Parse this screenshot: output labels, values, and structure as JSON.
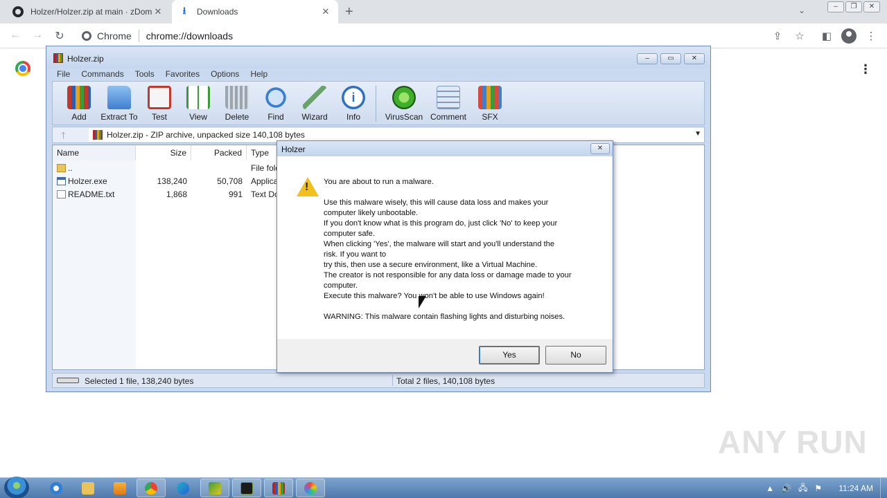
{
  "browser": {
    "tabs": [
      {
        "title": "Holzer/Holzer.zip at main · zDom",
        "icon": "github-icon"
      },
      {
        "title": "Downloads",
        "icon": "download-icon"
      }
    ],
    "site_chip": "Chrome",
    "url": "chrome://downloads"
  },
  "winrar": {
    "title": "Holzer.zip",
    "menu": [
      "File",
      "Commands",
      "Tools",
      "Favorites",
      "Options",
      "Help"
    ],
    "tools": [
      {
        "label": "Add",
        "icon": "add-archive-icon",
        "color": "#c0392b"
      },
      {
        "label": "Extract To",
        "icon": "extract-folder-icon",
        "color": "#4a8fd8"
      },
      {
        "label": "Test",
        "icon": "test-clipboard-icon",
        "color": "#c0392b"
      },
      {
        "label": "View",
        "icon": "view-book-icon",
        "color": "#3a9a3a"
      },
      {
        "label": "Delete",
        "icon": "delete-bin-icon",
        "color": "#8a96a3"
      },
      {
        "label": "Find",
        "icon": "find-magnifier-icon",
        "color": "#3a7fd0"
      },
      {
        "label": "Wizard",
        "icon": "wizard-wand-icon",
        "color": "#6aa36a"
      },
      {
        "label": "Info",
        "icon": "info-icon",
        "color": "#2f6fc4"
      },
      {
        "label": "VirusScan",
        "icon": "virusscan-icon",
        "color": "#3fae2a"
      },
      {
        "label": "Comment",
        "icon": "comment-icon",
        "color": "#7f9cc0"
      },
      {
        "label": "SFX",
        "icon": "sfx-icon",
        "color": "#d84b3a"
      }
    ],
    "path_text": "Holzer.zip - ZIP archive, unpacked size 140,108 bytes",
    "columns": [
      "Name",
      "Size",
      "Packed",
      "Type"
    ],
    "files": [
      {
        "name": "..",
        "size": "",
        "packed": "",
        "type": "File fold",
        "icon": "folder-icon"
      },
      {
        "name": "Holzer.exe",
        "size": "138,240",
        "packed": "50,708",
        "type": "Applica",
        "icon": "exe-file-icon"
      },
      {
        "name": "README.txt",
        "size": "1,868",
        "packed": "991",
        "type": "Text Do",
        "icon": "text-file-icon"
      }
    ],
    "status_left": "Selected 1 file, 138,240 bytes",
    "status_right": "Total 2 files, 140,108 bytes"
  },
  "dialog": {
    "title": "Holzer",
    "lines": [
      "You are about to run a malware.",
      "",
      "Use this malware wisely, this will cause data loss and makes your",
      "computer likely unbootable.",
      "If you don't know what is this program do, just click 'No' to keep your",
      "computer safe.",
      "When clicking 'Yes', the malware will start and you'll understand the",
      "risk. If you want to",
      "try this, then use a secure environment, like a Virtual Machine.",
      "The creator is not responsible for any data loss or damage made to your",
      "computer.",
      "Execute this malware? You won't be able to use Windows again!",
      "",
      "WARNING: This malware contain flashing lights and disturbing noises."
    ],
    "yes_label": "Yes",
    "no_label": "No"
  },
  "watermark": "ANY RUN",
  "taskbar": {
    "apps": [
      "ie-icon",
      "explorer-icon",
      "media-player-icon",
      "chrome-icon",
      "edge-icon",
      "app-icon",
      "terminal-icon",
      "winrar-icon",
      "color-app-icon"
    ],
    "clock": "11:24 AM"
  }
}
